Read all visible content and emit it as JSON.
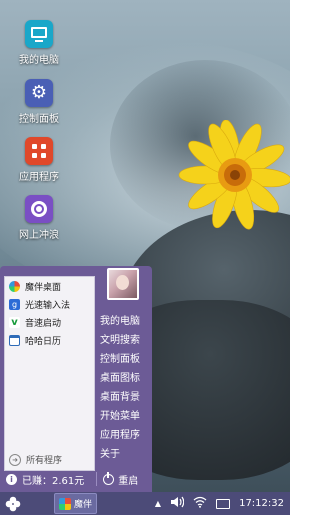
{
  "desktop": {
    "icons": [
      {
        "label": "我的电脑",
        "icon": "computer-icon",
        "color": "#1aa7c9"
      },
      {
        "label": "控制面板",
        "icon": "gear-icon",
        "color": "#4a5fb5"
      },
      {
        "label": "应用程序",
        "icon": "apps-icon",
        "color": "#e0482a"
      },
      {
        "label": "网上冲浪",
        "icon": "browser-icon",
        "color": "#7a4fc4"
      }
    ]
  },
  "start_menu": {
    "programs": [
      {
        "label": "魔伴桌面",
        "icon": "pinwheel-icon"
      },
      {
        "label": "光速输入法",
        "icon": "input-method-icon"
      },
      {
        "label": "音速启动",
        "icon": "launcher-icon"
      },
      {
        "label": "哈哈日历",
        "icon": "calendar-icon"
      }
    ],
    "all_programs": "所有程序",
    "right_links": [
      "我的电脑",
      "文明搜索",
      "控制面板",
      "桌面图标",
      "桌面背景",
      "开始菜单",
      "应用程序",
      "关于"
    ],
    "earnings": "已赚：2.61元",
    "restart": "重启"
  },
  "taskbar": {
    "app_label": "魔伴",
    "clock": "17:12:32"
  },
  "colors": {
    "menu_bg": "#6c5b96",
    "taskbar_bg": "#4c4b78"
  }
}
